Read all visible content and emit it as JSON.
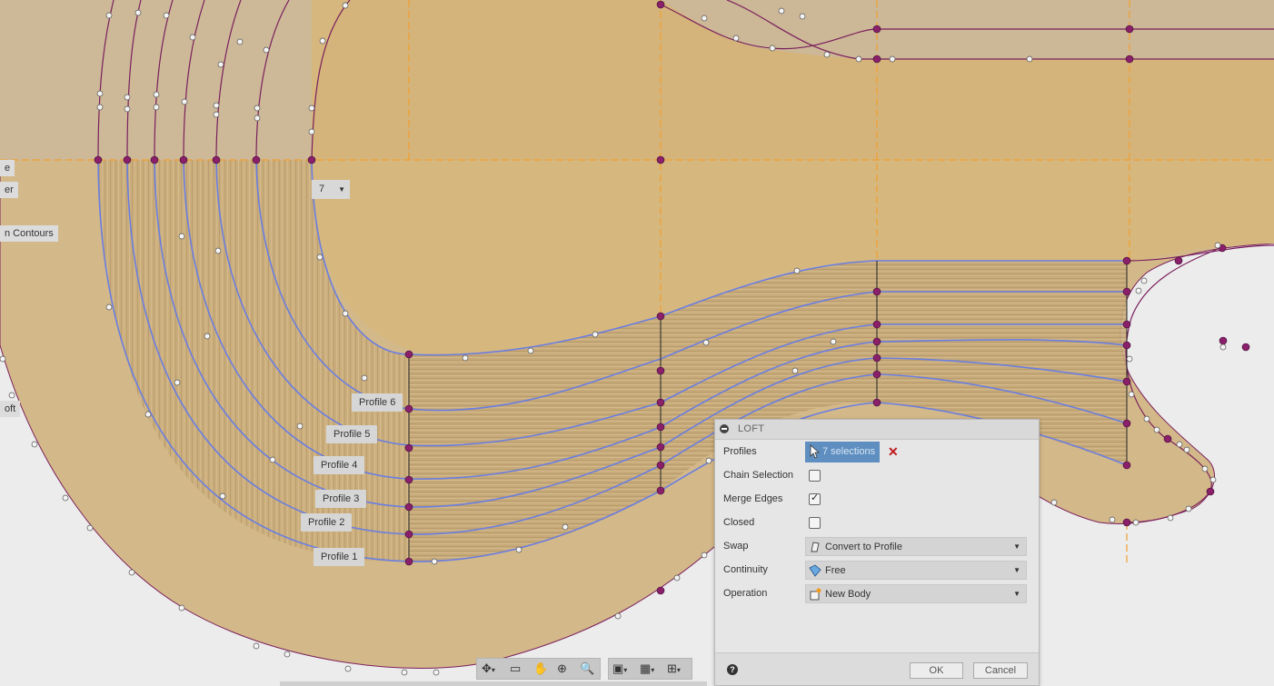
{
  "side_tags": [
    "e",
    "er",
    "n Contours",
    "oft"
  ],
  "profile_count_dropdown": "7",
  "profile_labels": [
    "Profile 6",
    "Profile 5",
    "Profile 4",
    "Profile 3",
    "Profile 2",
    "Profile 1"
  ],
  "loft": {
    "title": "LOFT",
    "profiles_label": "Profiles",
    "profiles_value": "7 selections",
    "chain_selection_label": "Chain Selection",
    "chain_selection_checked": false,
    "merge_edges_label": "Merge Edges",
    "merge_edges_checked": true,
    "closed_label": "Closed",
    "closed_checked": false,
    "swap_label": "Swap",
    "swap_value": "Convert to Profile",
    "continuity_label": "Continuity",
    "continuity_value": "Free",
    "operation_label": "Operation",
    "operation_value": "New Body",
    "ok_label": "OK",
    "cancel_label": "Cancel",
    "help_label": "?"
  },
  "nav_toolbar": [
    "orbit-icon",
    "look-at-icon",
    "pan-icon",
    "zoom-icon",
    "fit-icon",
    "display-settings-icon",
    "grid-settings-icon",
    "viewports-icon"
  ],
  "colors": {
    "sketch_line": "#7a1f5c",
    "profile_line": "#6a7ee0",
    "construction_line": "#f0a030",
    "body_fill": "#d7b77c",
    "selection_blue": "#5f8fc0"
  }
}
